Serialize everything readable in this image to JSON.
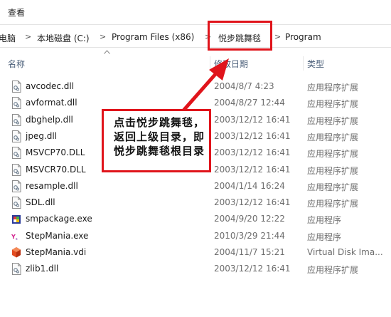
{
  "menu": {
    "view_label": "查看"
  },
  "address": {
    "crumbs": [
      "电脑",
      "本地磁盘 (C:)",
      "Program Files (x86)",
      "悦步跳舞毯",
      "Program"
    ],
    "separator": ">"
  },
  "columns": {
    "name": "名称",
    "date": "修改日期",
    "type": "类型"
  },
  "files": [
    {
      "name": "avcodec.dll",
      "date": "2004/8/7 4:23",
      "type": "应用程序扩展",
      "icon": "dll-file-icon"
    },
    {
      "name": "avformat.dll",
      "date": "2004/8/27 12:44",
      "type": "应用程序扩展",
      "icon": "dll-file-icon"
    },
    {
      "name": "dbghelp.dll",
      "date": "2003/12/12 16:41",
      "type": "应用程序扩展",
      "icon": "dll-file-icon"
    },
    {
      "name": "jpeg.dll",
      "date": "2003/12/12 16:41",
      "type": "应用程序扩展",
      "icon": "dll-file-icon"
    },
    {
      "name": "MSVCP70.DLL",
      "date": "2003/12/12 16:41",
      "type": "应用程序扩展",
      "icon": "dll-file-icon"
    },
    {
      "name": "MSVCR70.DLL",
      "date": "2003/12/12 16:41",
      "type": "应用程序扩展",
      "icon": "dll-file-icon"
    },
    {
      "name": "resample.dll",
      "date": "2004/1/14 16:24",
      "type": "应用程序扩展",
      "icon": "dll-file-icon"
    },
    {
      "name": "SDL.dll",
      "date": "2003/12/12 16:41",
      "type": "应用程序扩展",
      "icon": "dll-file-icon"
    },
    {
      "name": "smpackage.exe",
      "date": "2004/9/20 12:22",
      "type": "应用程序",
      "icon": "smpackage-app-icon"
    },
    {
      "name": "StepMania.exe",
      "date": "2010/3/29 21:44",
      "type": "应用程序",
      "icon": "stepmania-app-icon"
    },
    {
      "name": "StepMania.vdi",
      "date": "2004/11/7 15:21",
      "type": "Virtual Disk Ima...",
      "icon": "virtual-disk-icon"
    },
    {
      "name": "zlib1.dll",
      "date": "2003/12/12 16:41",
      "type": "应用程序扩展",
      "icon": "dll-file-icon"
    }
  ],
  "annotation": {
    "text": "点击悦步跳舞毯，返回上级目录，即悦步跳舞毯根目录"
  },
  "colors": {
    "annotation_red": "#e0141b",
    "header_text": "#4c607a",
    "meta_text": "#6d6d6d"
  }
}
